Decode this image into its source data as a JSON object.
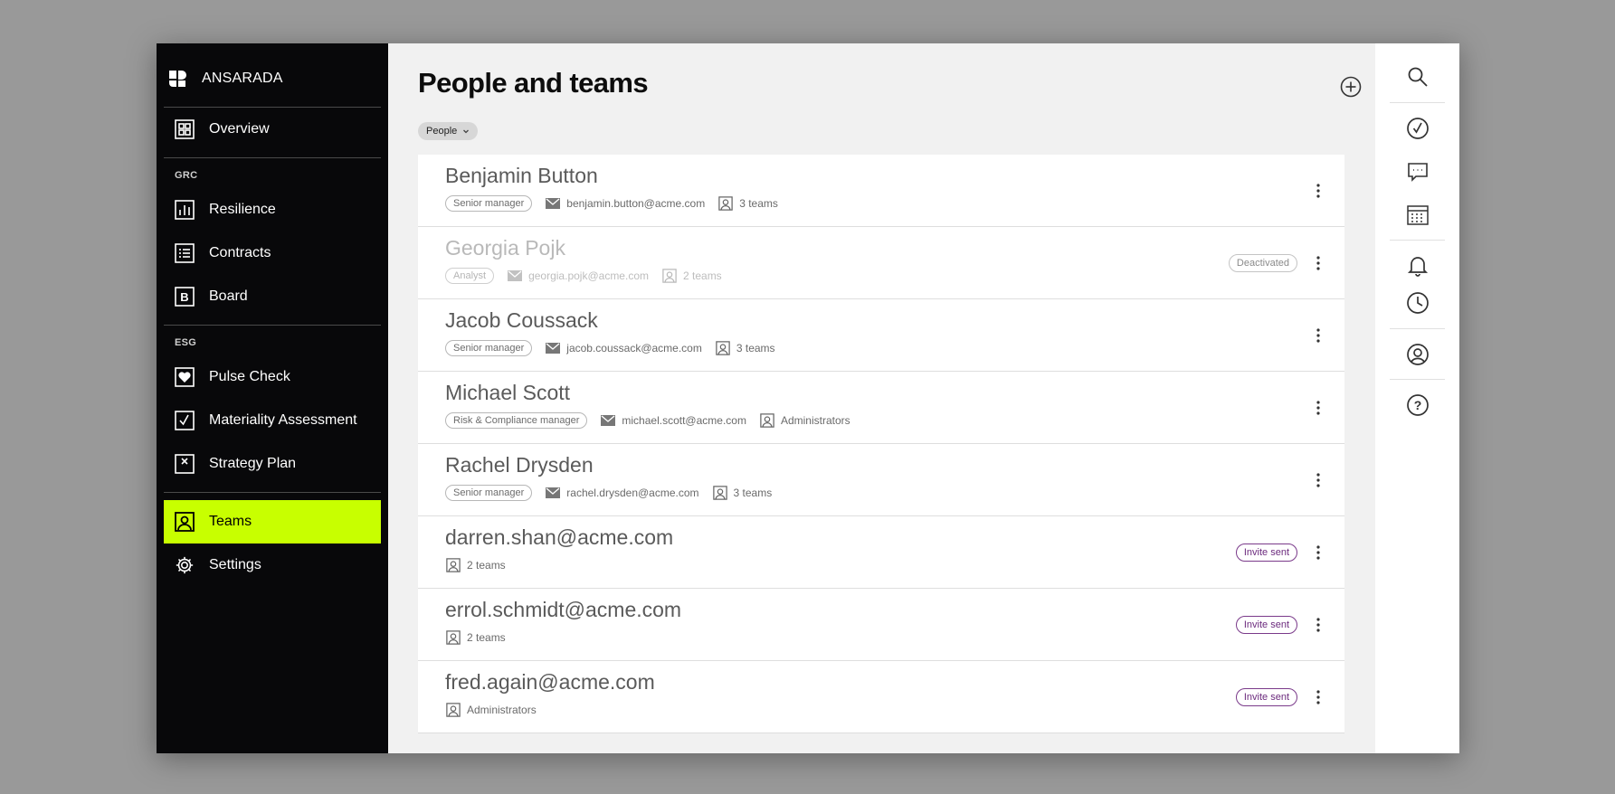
{
  "sidebar": {
    "brand": "ANSARADA",
    "overview": "Overview",
    "sections": [
      {
        "title": "GRC",
        "items": [
          {
            "label": "Resilience",
            "icon": "chart-bars-icon"
          },
          {
            "label": "Contracts",
            "icon": "list-icon"
          },
          {
            "label": "Board",
            "icon": "board-b-icon"
          }
        ]
      },
      {
        "title": "ESG",
        "items": [
          {
            "label": "Pulse Check",
            "icon": "heart-icon"
          },
          {
            "label": "Materiality Assessment",
            "icon": "check-box-icon"
          },
          {
            "label": "Strategy Plan",
            "icon": "x-box-icon"
          }
        ]
      }
    ],
    "teams": "Teams",
    "settings": "Settings",
    "accent": "#c8ff00"
  },
  "main": {
    "title": "People and teams",
    "filter": "People"
  },
  "people": [
    {
      "name": "Benjamin Button",
      "role": "Senior manager",
      "email": "benjamin.button@acme.com",
      "teams": "3 teams",
      "status": ""
    },
    {
      "name": "Georgia Pojk",
      "role": "Analyst",
      "email": "georgia.pojk@acme.com",
      "teams": "2 teams",
      "status": "Deactivated"
    },
    {
      "name": "Jacob Coussack",
      "role": "Senior manager",
      "email": "jacob.coussack@acme.com",
      "teams": "3 teams",
      "status": ""
    },
    {
      "name": "Michael Scott",
      "role": "Risk & Compliance manager",
      "email": "michael.scott@acme.com",
      "teams": "Administrators",
      "status": ""
    },
    {
      "name": "Rachel Drysden",
      "role": "Senior manager",
      "email": "rachel.drysden@acme.com",
      "teams": "3 teams",
      "status": ""
    },
    {
      "name": "darren.shan@acme.com",
      "teams": "2 teams",
      "status": "Invite sent"
    },
    {
      "name": "errol.schmidt@acme.com",
      "teams": "2 teams",
      "status": "Invite sent"
    },
    {
      "name": "fred.again@acme.com",
      "teams": "Administrators",
      "status": "Invite sent"
    }
  ],
  "rail": [
    "search-icon",
    "check-circle-icon",
    "comment-icon",
    "calendar-icon",
    "bell-icon",
    "clock-icon",
    "profile-icon",
    "help-icon"
  ]
}
